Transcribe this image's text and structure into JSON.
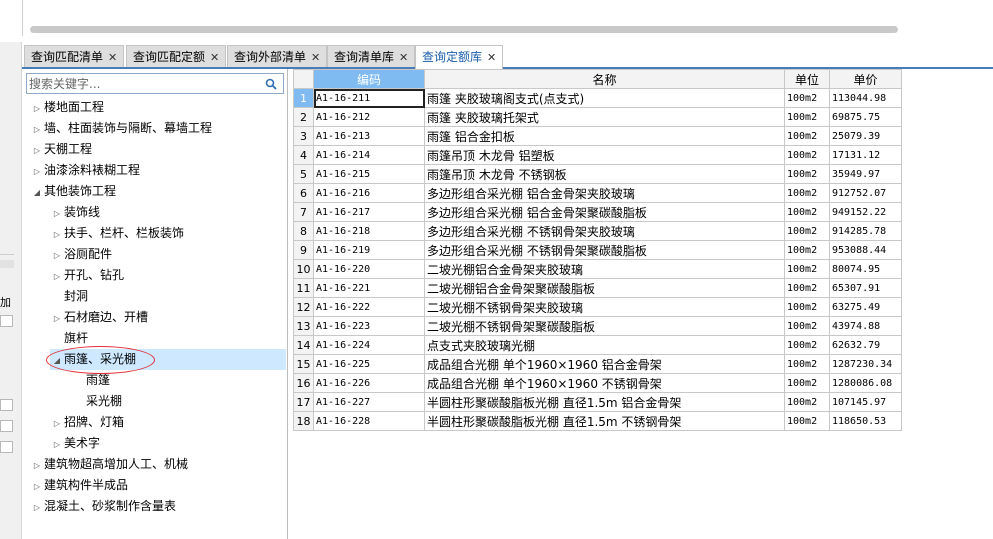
{
  "tabs": [
    {
      "label": "查询匹配清单",
      "active": false
    },
    {
      "label": "查询匹配定额",
      "active": false
    },
    {
      "label": "查询外部清单",
      "active": false
    },
    {
      "label": "查询清单库",
      "active": false
    },
    {
      "label": "查询定额库",
      "active": true
    }
  ],
  "tab_close_glyph": "✕",
  "left_strip": {
    "label": "加"
  },
  "search": {
    "placeholder": "搜索关键字..."
  },
  "tree": {
    "items": [
      {
        "label": "楼地面工程",
        "expanded": false
      },
      {
        "label": "墙、柱面装饰与隔断、幕墙工程",
        "expanded": false
      },
      {
        "label": "天棚工程",
        "expanded": false
      },
      {
        "label": "油漆涂料裱糊工程",
        "expanded": false
      },
      {
        "label": "其他装饰工程",
        "expanded": true
      },
      {
        "label": "装饰线",
        "expanded": false
      },
      {
        "label": "扶手、栏杆、栏板装饰",
        "expanded": false
      },
      {
        "label": "浴厕配件",
        "expanded": false
      },
      {
        "label": "开孔、钻孔",
        "expanded": false
      },
      {
        "label": "封洞",
        "expanded": null
      },
      {
        "label": "石材磨边、开槽",
        "expanded": false
      },
      {
        "label": "旗杆",
        "expanded": null
      },
      {
        "label": "雨篷、采光棚",
        "expanded": true,
        "selected": true
      },
      {
        "label": "雨篷",
        "expanded": null
      },
      {
        "label": "采光棚",
        "expanded": null
      },
      {
        "label": "招牌、灯箱",
        "expanded": false
      },
      {
        "label": "美术字",
        "expanded": false
      },
      {
        "label": "建筑物超高增加人工、机械",
        "expanded": false
      },
      {
        "label": "建筑构件半成品",
        "expanded": false
      },
      {
        "label": "混凝土、砂浆制作含量表",
        "expanded": false
      }
    ]
  },
  "grid": {
    "headers": {
      "code": "编码",
      "name": "名称",
      "unit": "单位",
      "price": "单价"
    },
    "rows": [
      {
        "n": "1",
        "code": "A1-16-211",
        "name": "雨篷 夹胶玻璃阁支式(点支式)",
        "unit": "100m2",
        "price": "113044.98"
      },
      {
        "n": "2",
        "code": "A1-16-212",
        "name": "雨篷 夹胶玻璃托架式",
        "unit": "100m2",
        "price": "69875.75"
      },
      {
        "n": "3",
        "code": "A1-16-213",
        "name": "雨篷 铝合金扣板",
        "unit": "100m2",
        "price": "25079.39"
      },
      {
        "n": "4",
        "code": "A1-16-214",
        "name": "雨篷吊顶 木龙骨 铝塑板",
        "unit": "100m2",
        "price": "17131.12"
      },
      {
        "n": "5",
        "code": "A1-16-215",
        "name": "雨篷吊顶 木龙骨 不锈钢板",
        "unit": "100m2",
        "price": "35949.97"
      },
      {
        "n": "6",
        "code": "A1-16-216",
        "name": "多边形组合采光棚 铝合金骨架夹胶玻璃",
        "unit": "100m2",
        "price": "912752.07"
      },
      {
        "n": "7",
        "code": "A1-16-217",
        "name": "多边形组合采光棚 铝合金骨架聚碳酸脂板",
        "unit": "100m2",
        "price": "949152.22"
      },
      {
        "n": "8",
        "code": "A1-16-218",
        "name": "多边形组合采光棚 不锈钢骨架夹胶玻璃",
        "unit": "100m2",
        "price": "914285.78"
      },
      {
        "n": "9",
        "code": "A1-16-219",
        "name": "多边形组合采光棚 不锈钢骨架聚碳酸脂板",
        "unit": "100m2",
        "price": "953088.44"
      },
      {
        "n": "10",
        "code": "A1-16-220",
        "name": "二坡光棚铝合金骨架夹胶玻璃",
        "unit": "100m2",
        "price": "80074.95"
      },
      {
        "n": "11",
        "code": "A1-16-221",
        "name": "二坡光棚铝合金骨架聚碳酸脂板",
        "unit": "100m2",
        "price": "65307.91"
      },
      {
        "n": "12",
        "code": "A1-16-222",
        "name": "二坡光棚不锈钢骨架夹胶玻璃",
        "unit": "100m2",
        "price": "63275.49"
      },
      {
        "n": "13",
        "code": "A1-16-223",
        "name": "二坡光棚不锈钢骨架聚碳酸脂板",
        "unit": "100m2",
        "price": "43974.88"
      },
      {
        "n": "14",
        "code": "A1-16-224",
        "name": "点支式夹胶玻璃光棚",
        "unit": "100m2",
        "price": "62632.79"
      },
      {
        "n": "15",
        "code": "A1-16-225",
        "name": "成品组合光棚 单个1960×1960 铝合金骨架",
        "unit": "100m2",
        "price": "1287230.34"
      },
      {
        "n": "16",
        "code": "A1-16-226",
        "name": "成品组合光棚 单个1960×1960 不锈钢骨架",
        "unit": "100m2",
        "price": "1280086.08"
      },
      {
        "n": "17",
        "code": "A1-16-227",
        "name": "半圆柱形聚碳酸脂板光棚 直径1.5m 铝合金骨架",
        "unit": "100m2",
        "price": "107145.97"
      },
      {
        "n": "18",
        "code": "A1-16-228",
        "name": "半圆柱形聚碳酸脂板光棚 直径1.5m 不锈钢骨架",
        "unit": "100m2",
        "price": "118650.53"
      }
    ]
  },
  "colors": {
    "accent": "#4a7cb8",
    "header_highlight": "#7fbaf0",
    "selection": "#cde8ff",
    "annotation": "#e0303a"
  }
}
